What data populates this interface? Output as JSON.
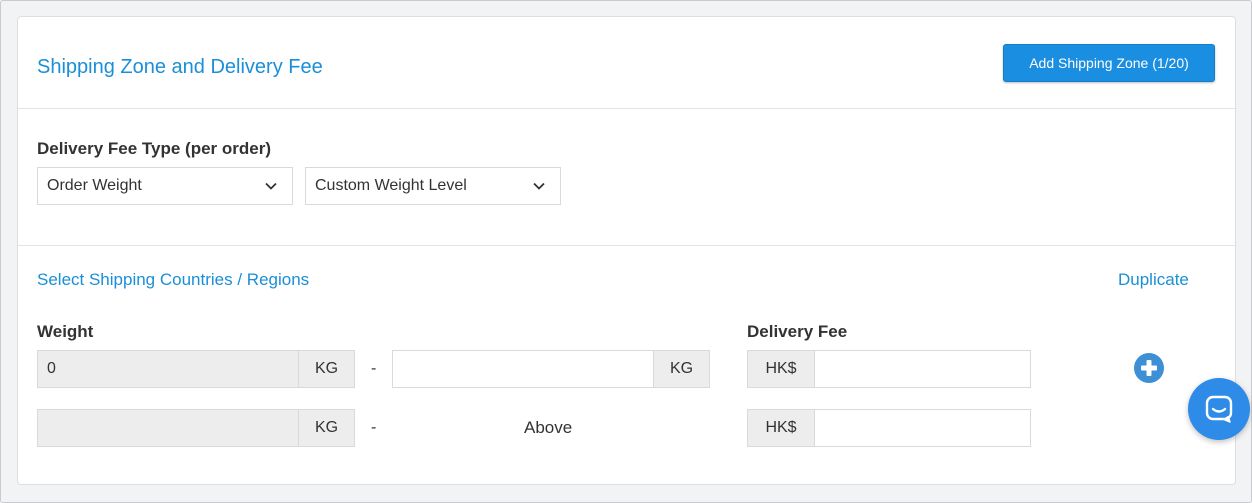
{
  "header": {
    "title": "Shipping Zone and Delivery Fee",
    "add_zone_label": "Add Shipping Zone (1/20)"
  },
  "fee_type": {
    "label": "Delivery Fee Type (per order)",
    "type_select": "Order Weight",
    "level_select": "Custom Weight Level"
  },
  "countries": {
    "select_link": "Select Shipping Countries / Regions",
    "duplicate_link": "Duplicate"
  },
  "weight": {
    "label": "Weight",
    "unit": "KG",
    "separator": "-",
    "rows": [
      {
        "from_value": "0",
        "to_value": ""
      },
      {
        "from_value": "",
        "to_text": "Above"
      }
    ]
  },
  "delivery_fee": {
    "label": "Delivery Fee",
    "currency": "HK$",
    "rows": [
      {
        "value": ""
      },
      {
        "value": ""
      }
    ]
  },
  "colors": {
    "accent": "#1a8fd8",
    "button": "#1a8ee0",
    "chat": "#2e8be8"
  },
  "icons": {
    "dropdown": "chevron-down-icon",
    "add_row": "plus-circle-icon",
    "chat": "chat-bubble-icon"
  }
}
